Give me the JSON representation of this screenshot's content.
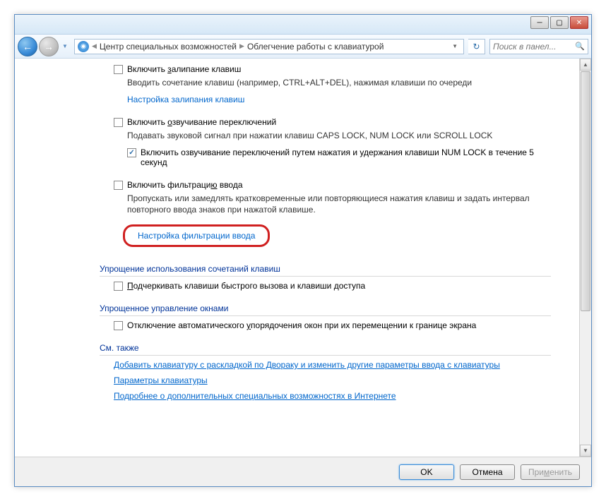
{
  "breadcrumb": {
    "part1": "Центр специальных возможностей",
    "part2": "Облегчение работы с клавиатурой"
  },
  "search": {
    "placeholder": "Поиск в панел..."
  },
  "sticky": {
    "label_pre": "Включить ",
    "label_ul": "з",
    "label_post": "алипание клавиш",
    "desc": "Вводить сочетание клавиш (например, CTRL+ALT+DEL), нажимая клавиши по очереди",
    "link": "Настройка залипания клавиш"
  },
  "toggle": {
    "label_pre": "Включить ",
    "label_ul": "о",
    "label_post": "звучивание переключений",
    "desc": "Подавать звуковой сигнал при нажатии клавиш CAPS LOCK, NUM LOCK или SCROLL LOCK",
    "sub_label": "Включить озвучивание переключений путем нажатия и удержания клавиши NUM LOCK в течение 5 секунд"
  },
  "filter": {
    "label_pre": "Включить фильтраци",
    "label_ul": "ю",
    "label_post": " ввода",
    "desc": "Пропускать или замедлять кратковременные или повторяющиеся нажатия клавиш и задать интервал повторного ввода знаков при нажатой клавише.",
    "link": "Настройка фильтрации ввода"
  },
  "sections": {
    "shortcuts": "Упрощение использования сочетаний клавиш",
    "shortcuts_opt_pre": "",
    "shortcuts_opt_ul": "П",
    "shortcuts_opt_post": "одчеркивать клавиши быстрого вызова и клавиши доступа",
    "windows": "Упрощенное управление окнами",
    "windows_opt_pre": "Отключение автоматического ",
    "windows_opt_ul": "у",
    "windows_opt_post": "порядочения окон при их перемещении к границе экрана",
    "seealso": "См. также"
  },
  "links": {
    "dvorak": "Добавить клавиатуру с раскладкой по Двораку и изменить другие параметры ввода с клавиатуры",
    "params": "Параметры клавиатуры",
    "online": "Подробнее о дополнительных специальных возможностях в Интернете"
  },
  "buttons": {
    "ok": "OK",
    "cancel": "Отмена",
    "apply_pre": "При",
    "apply_ul": "м",
    "apply_post": "енить"
  }
}
